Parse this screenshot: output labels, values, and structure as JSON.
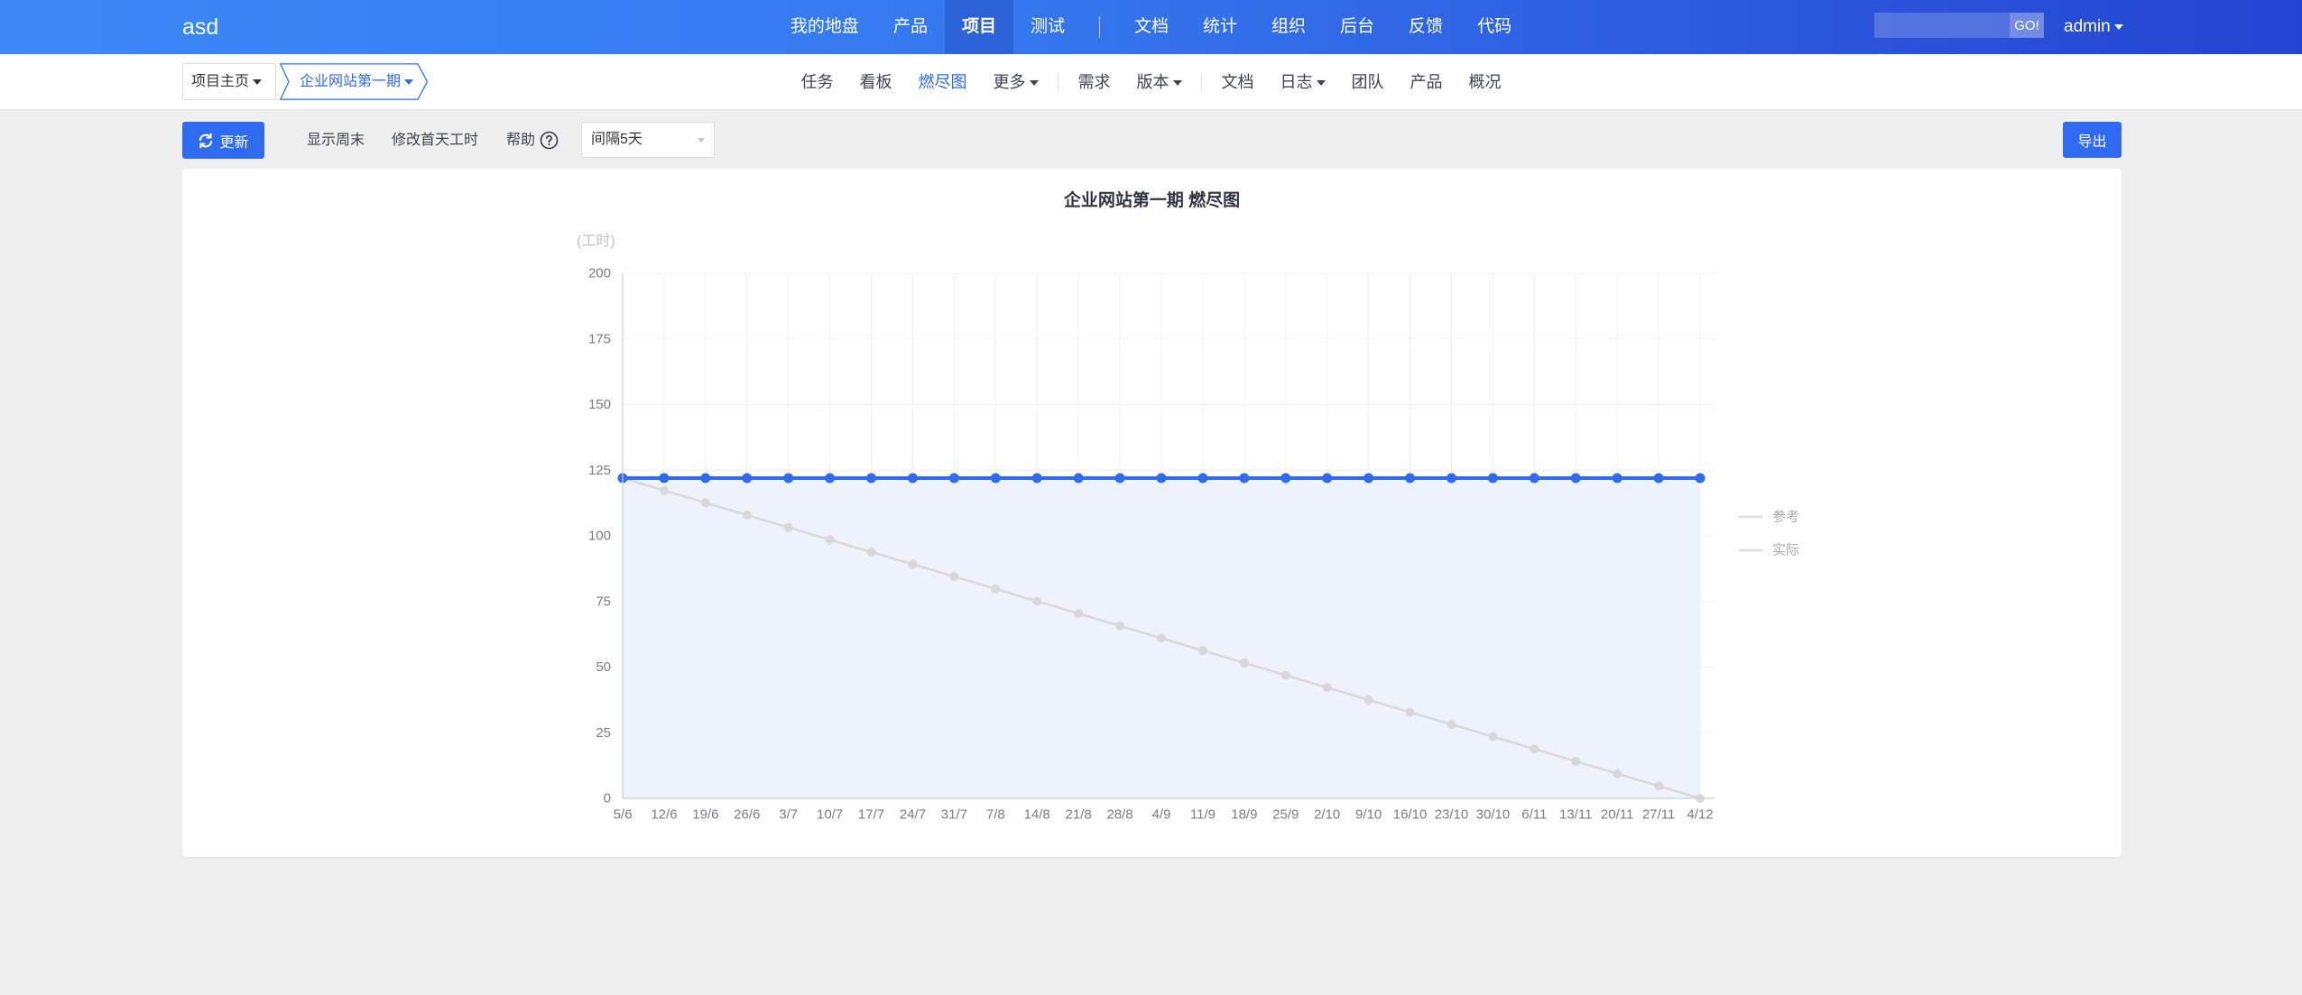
{
  "brand": "asd",
  "colors": {
    "accent": "#2e6bf0",
    "header_start": "#3c89f7",
    "header_end": "#2445d1",
    "page_bg": "#efefef"
  },
  "nav": {
    "items": [
      {
        "label": "我的地盘"
      },
      {
        "label": "产品"
      },
      {
        "label": "项目",
        "active": true
      },
      {
        "label": "测试"
      },
      {
        "label": "文档"
      },
      {
        "label": "统计"
      },
      {
        "label": "组织"
      },
      {
        "label": "后台"
      },
      {
        "label": "反馈"
      },
      {
        "label": "代码"
      }
    ]
  },
  "search": {
    "value": "",
    "button": "GO!"
  },
  "user": {
    "name": "admin",
    "icon": "caret-down-icon"
  },
  "breadcrumb": {
    "home": "项目主页",
    "current": "企业网站第一期"
  },
  "subnav": {
    "items": [
      {
        "label": "任务"
      },
      {
        "label": "看板"
      },
      {
        "label": "燃尽图",
        "active": true
      },
      {
        "label": "更多",
        "dropdown": true
      },
      {
        "label": "需求"
      },
      {
        "label": "版本",
        "dropdown": true
      },
      {
        "label": "文档"
      },
      {
        "label": "日志",
        "dropdown": true
      },
      {
        "label": "团队"
      },
      {
        "label": "产品"
      },
      {
        "label": "概况"
      }
    ]
  },
  "toolbar": {
    "refresh": "更新",
    "refresh_icon": "refresh-icon",
    "show_weekend": "显示周末",
    "edit_first_day_hours": "修改首天工时",
    "help": "帮助",
    "help_icon": "question-circle-icon",
    "interval": "间隔5天",
    "export": "导出"
  },
  "chart_data": {
    "type": "line",
    "title": "企业网站第一期 燃尽图",
    "ylabel": "(工时)",
    "ylim": [
      0,
      200
    ],
    "yticks": [
      0,
      25,
      50,
      75,
      100,
      125,
      150,
      175,
      200
    ],
    "grid": true,
    "legend": "right",
    "x": [
      "5/6",
      "12/6",
      "19/6",
      "26/6",
      "3/7",
      "10/7",
      "17/7",
      "24/7",
      "31/7",
      "7/8",
      "14/8",
      "21/8",
      "28/8",
      "4/9",
      "11/9",
      "18/9",
      "25/9",
      "2/10",
      "9/10",
      "16/10",
      "23/10",
      "30/10",
      "6/11",
      "13/11",
      "20/11",
      "27/11",
      "4/12"
    ],
    "series": [
      {
        "name": "参考",
        "color": "#d8d8d8",
        "values": [
          122,
          117.3,
          112.6,
          107.9,
          103.2,
          98.5,
          93.8,
          89.2,
          84.5,
          79.8,
          75.1,
          70.4,
          65.7,
          61,
          56.3,
          51.6,
          46.9,
          42.2,
          37.5,
          32.8,
          28.2,
          23.5,
          18.8,
          14.1,
          9.4,
          4.7,
          0
        ]
      },
      {
        "name": "实际",
        "color": "#2e6bf0",
        "area": true,
        "area_color": "#edf2fd",
        "values": [
          122,
          122,
          122,
          122,
          122,
          122,
          122,
          122,
          122,
          122,
          122,
          122,
          122,
          122,
          122,
          122,
          122,
          122,
          122,
          122,
          122,
          122,
          122,
          122,
          122,
          122,
          122
        ]
      }
    ]
  }
}
